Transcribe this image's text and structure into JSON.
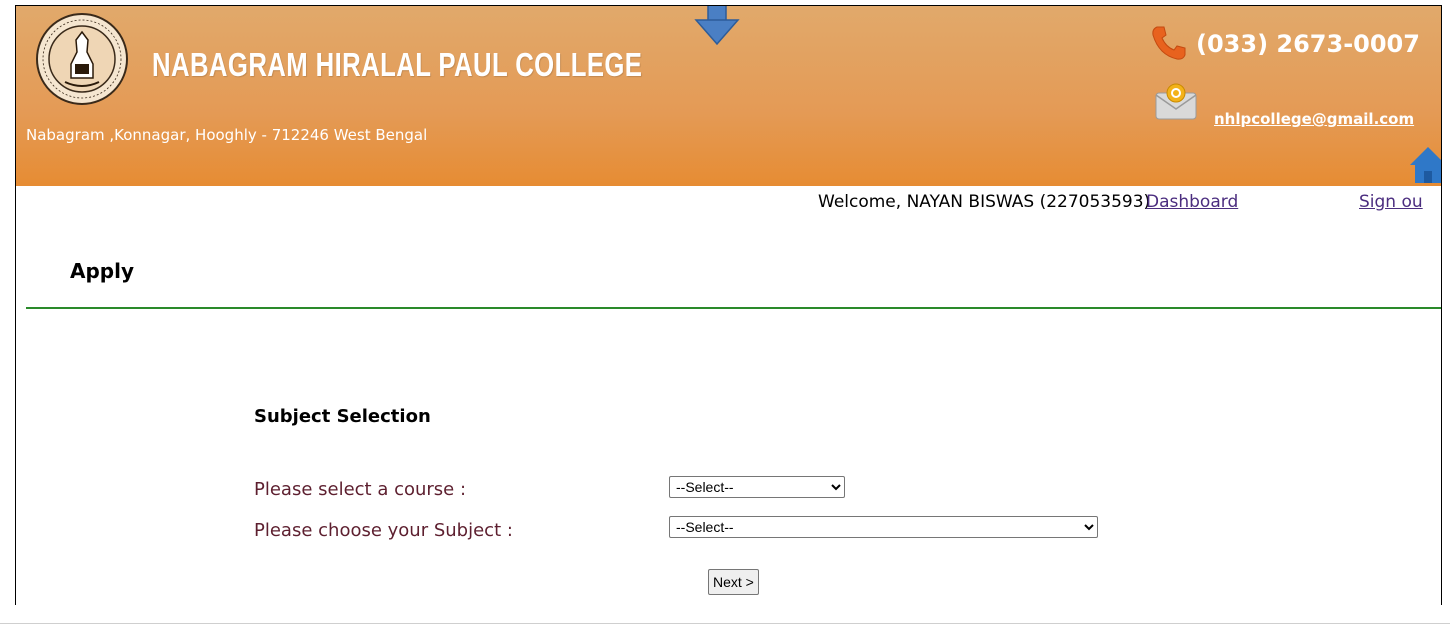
{
  "header": {
    "college_name": "NABAGRAM HIRALAL PAUL COLLEGE",
    "address": "Nabagram ,Konnagar, Hooghly - 712246 West Bengal",
    "phone": "(033) 2673-0007",
    "email": "nhlpcollege@gmail.com",
    "icons": [
      "college-logo",
      "phone-icon",
      "mail-icon",
      "home-icon",
      "down-arrow-icon"
    ],
    "colors": {
      "header_top": "#e1a96b",
      "header_bottom": "#e68c33"
    }
  },
  "user_bar": {
    "welcome": "Welcome, NAYAN BISWAS (227053593)",
    "dashboard_label": "Dashboard",
    "signout_label": "Sign ou"
  },
  "page": {
    "title": "Apply",
    "section_title": "Subject Selection",
    "course_label": "Please select a course :",
    "course_value": "--Select--",
    "subject_label": "Please choose your Subject :",
    "subject_value": "--Select--",
    "next_label": "Next >"
  },
  "colors": {
    "label": "#5d1f2f",
    "link": "#4b2d7f",
    "divider": "#2a8a2a"
  }
}
